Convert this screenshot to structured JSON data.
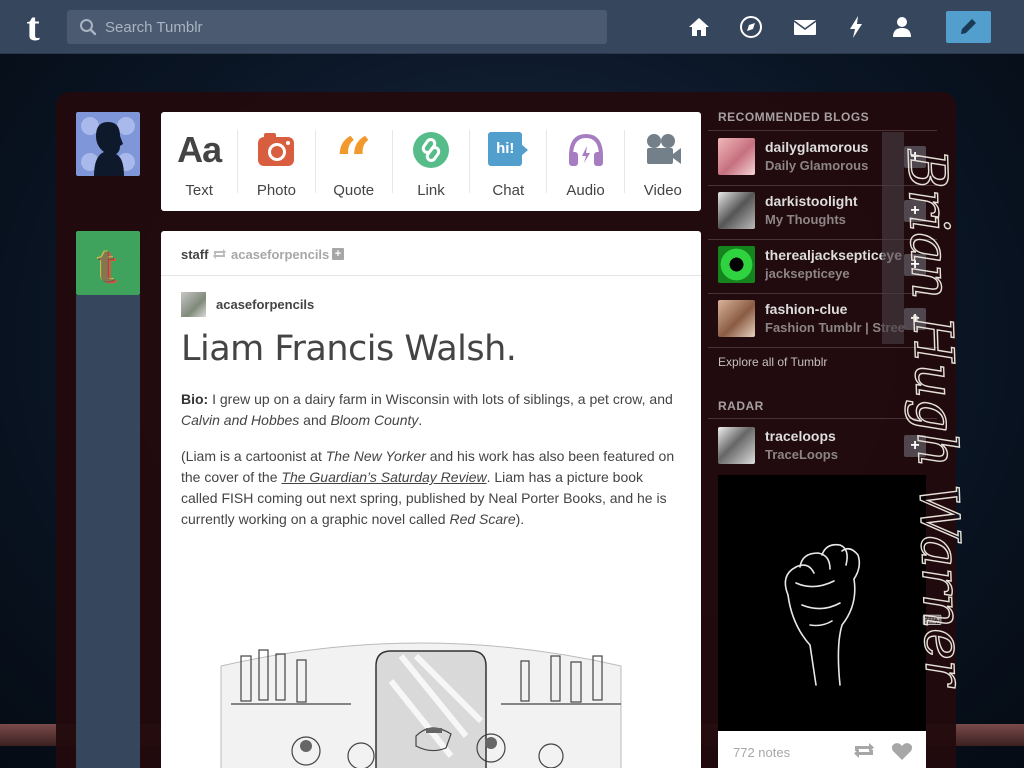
{
  "header": {
    "logo": "t",
    "search_placeholder": "Search Tumblr",
    "nav_icons": [
      "home-icon",
      "explore-icon",
      "inbox-icon",
      "activity-icon",
      "account-icon"
    ],
    "compose_icon": "pencil-icon",
    "colors": {
      "bar": "#36465d",
      "compose": "#529ecc"
    }
  },
  "post_types": [
    {
      "label": "Text",
      "glyph": "Aa",
      "color": "#444444"
    },
    {
      "label": "Photo",
      "color": "#d95e40"
    },
    {
      "label": "Quote",
      "color": "#f2992e"
    },
    {
      "label": "Link",
      "color": "#56bc8a"
    },
    {
      "label": "Chat",
      "glyph": "hi!",
      "color": "#529ecc"
    },
    {
      "label": "Audio",
      "color": "#a77dc2"
    },
    {
      "label": "Video",
      "color": "#748089"
    }
  ],
  "post": {
    "reblogger": "staff",
    "reblogged_from": "acaseforpencils",
    "author": "acaseforpencils",
    "title": "Liam Francis Walsh.",
    "bio_label": "Bio:",
    "bio_text": " I grew up on a dairy farm in Wisconsin with lots of siblings, a pet crow, and ",
    "bio_i1": "Calvin and Hobbes",
    "bio_and": " and ",
    "bio_i2": "Bloom County",
    "bio_end": ".",
    "p2_a": "(Liam is a cartoonist at ",
    "p2_i1": "The New Yorker",
    "p2_b": " and his work has also been featured on the cover of the ",
    "p2_link": "The Guardian’s Saturday Review",
    "p2_c": ". Liam has a picture book called FISH coming out next spring, published by Neal Porter Books, and he is currently working on a graphic novel called ",
    "p2_i2": "Red Scare",
    "p2_d": ")."
  },
  "sidebar": {
    "recommended_heading": "RECOMMENDED BLOGS",
    "blogs": [
      {
        "name": "dailyglamorous",
        "title": "Daily Glamorous"
      },
      {
        "name": "darkistoolight",
        "title": "My Thoughts"
      },
      {
        "name": "therealjacksepticeye",
        "title": "jacksepticeye"
      },
      {
        "name": "fashion-clue",
        "title": "Fashion Tumblr | Street Style"
      }
    ],
    "explore_link": "Explore all of Tumblr",
    "radar_heading": "RADAR",
    "radar": {
      "name": "traceloops",
      "title": "TraceLoops",
      "notes": "772 notes"
    },
    "follow_symbol": "+"
  },
  "background_text": "Brian Hugh Warner"
}
